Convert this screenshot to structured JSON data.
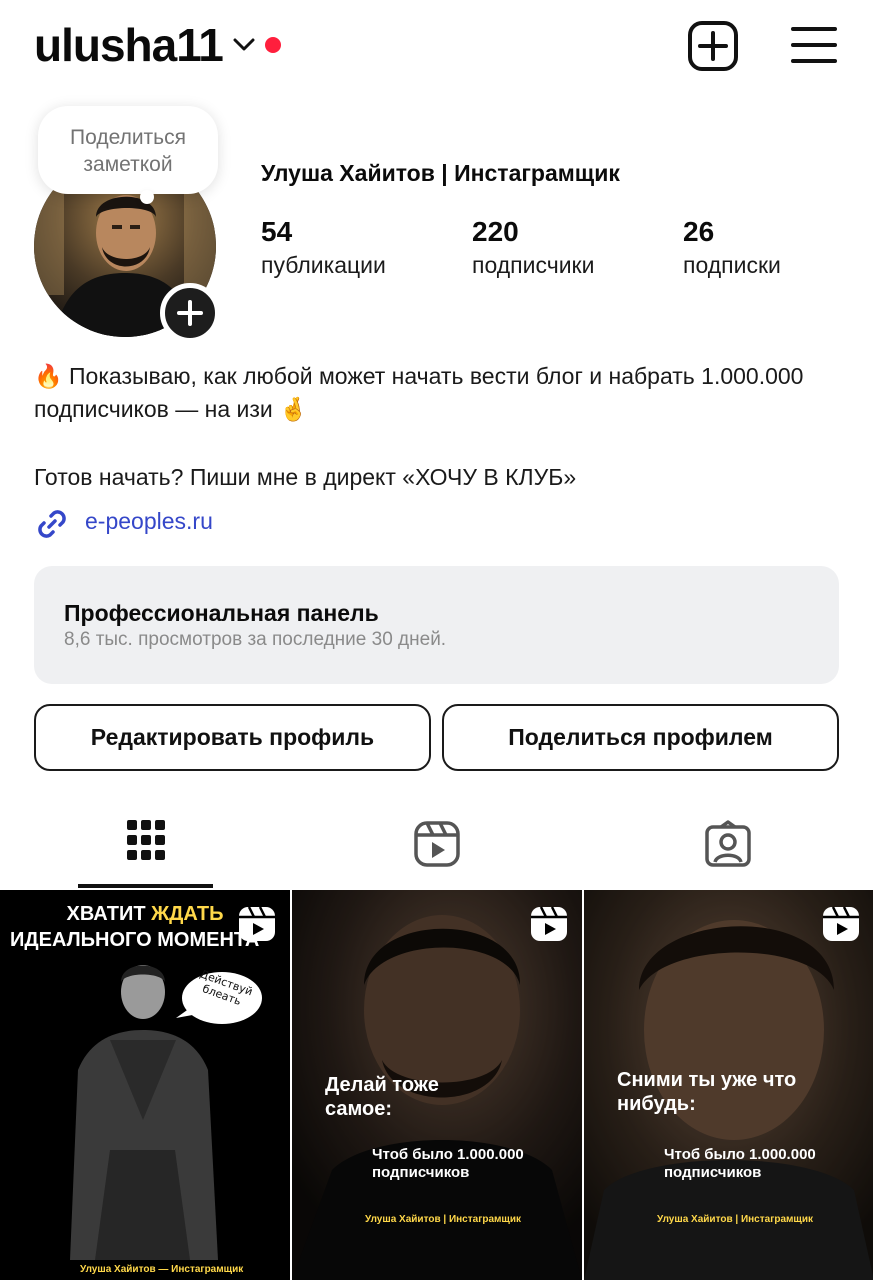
{
  "header": {
    "username": "ulusha11"
  },
  "profile": {
    "note_bubble": "Поделиться заметкой",
    "full_name": "Улуша Хайитов | Инстаграмщик",
    "stats": [
      {
        "value": "54",
        "label": "публикации"
      },
      {
        "value": "220",
        "label": "подписчики"
      },
      {
        "value": "26",
        "label": "подписки"
      }
    ]
  },
  "bio": {
    "line1": "🔥 Показываю, как любой может начать вести блог и набрать 1.000.000 подписчиков — на изи 🤞",
    "line2": "Готов начать? Пиши мне в директ «ХОЧУ В КЛУБ»",
    "link": "e-peoples.ru"
  },
  "pro_panel": {
    "title": "Профессиональная панель",
    "subtitle": "8,6 тыс. просмотров за последние 30 дней."
  },
  "buttons": {
    "edit": "Редактировать профиль",
    "share": "Поделиться профилем"
  },
  "tabs": {
    "active": "grid"
  },
  "posts": [
    {
      "title_a": "ХВАТИТ",
      "title_b": "ЖДАТЬ",
      "title_c": "ИДЕАЛЬНОГО МОМЕНТА",
      "bubble": "Действуй блеать",
      "footer": "Улуша Хайитов — Инстаграмщик"
    },
    {
      "main": "Делай тоже самое:",
      "sub": "Чтоб было 1.000.000 подписчиков",
      "footer": "Улуша Хайитов | Инстаграмщик"
    },
    {
      "main": "Сними ты уже что нибудь:",
      "sub": "Чтоб было 1.000.000 подписчиков",
      "footer": "Улуша Хайитов | Инстаграмщик"
    }
  ],
  "colors": {
    "accent_link": "#3547c9",
    "notification_dot": "#ff1f3d",
    "panel_bg": "#eff0f2",
    "highlight_yellow": "#ffd84a"
  }
}
